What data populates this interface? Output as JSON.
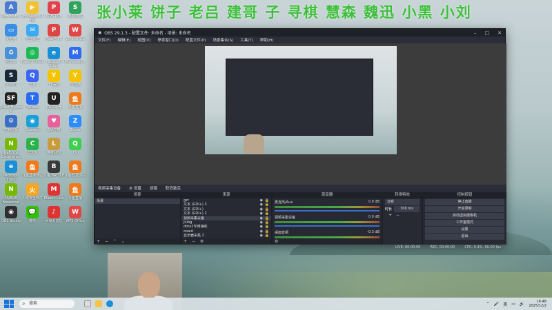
{
  "banner": "张小莱 饼子 老吕  建哥  子    寻棋  慧森 魏迅 小黑 小刘",
  "desktop_icons": [
    {
      "label": "Administr...",
      "color": "#4a7bd1",
      "glyph": "A"
    },
    {
      "label": "PotPlayer 64 bit",
      "color": "#f2c12e",
      "glyph": "▶"
    },
    {
      "label": "WPS PDF",
      "color": "#e0434c",
      "glyph": "P"
    },
    {
      "label": "WPS表格",
      "color": "#2fa35b",
      "glyph": "S"
    },
    {
      "label": "此电脑",
      "color": "#3a8ee6",
      "glyph": "▭"
    },
    {
      "label": "企业微信",
      "color": "#3ea8f0",
      "glyph": "✉"
    },
    {
      "label": "Pixel 4 FX",
      "color": "#d44",
      "glyph": "P"
    },
    {
      "label": "WPS Office",
      "color": "#e04848",
      "glyph": "W"
    },
    {
      "label": "回收站",
      "color": "#4a90d9",
      "glyph": "♻"
    },
    {
      "label": "Razer Cortex",
      "color": "#1db954",
      "glyph": "◎"
    },
    {
      "label": "Microsoft Edge",
      "color": "#1b8fd6",
      "glyph": "e"
    },
    {
      "label": "MoveMate...",
      "color": "#2f6cf0",
      "glyph": "M"
    },
    {
      "label": "Steam",
      "color": "#1b2838",
      "glyph": "S"
    },
    {
      "label": "夸克",
      "color": "#3b65f5",
      "glyph": "Q"
    },
    {
      "label": "YY语音",
      "color": "#f5c400",
      "glyph": "Y"
    },
    {
      "label": "YY直播",
      "color": "#f5c400",
      "glyph": "Y"
    },
    {
      "label": "Street Fighter 6",
      "color": "#222",
      "glyph": "SF"
    },
    {
      "label": "ToDesk",
      "color": "#2a6cf0",
      "glyph": "T"
    },
    {
      "label": "UU加速器",
      "color": "#222",
      "glyph": "U"
    },
    {
      "label": "斗鱼直播",
      "color": "#f07a1b",
      "glyph": "鱼"
    },
    {
      "label": "控制面板",
      "color": "#3a6fc4",
      "glyph": "⚙"
    },
    {
      "label": "Connect",
      "color": "#1a9fd6",
      "glyph": "◉"
    },
    {
      "label": "IDA应用",
      "color": "#e8609c",
      "glyph": "♥"
    },
    {
      "label": "Zoom",
      "color": "#2d8cff",
      "glyph": "Z"
    },
    {
      "label": "GeForce Experience",
      "color": "#76b900",
      "glyph": "N"
    },
    {
      "label": "CODK",
      "color": "#2bb24c",
      "glyph": "C"
    },
    {
      "label": "英雄联盟",
      "color": "#c89b3c",
      "glyph": "L"
    },
    {
      "label": "Qt",
      "color": "#41cd52",
      "glyph": "Q"
    },
    {
      "label": "Microsoft Edge",
      "color": "#1b8fd6",
      "glyph": "e"
    },
    {
      "label": "斗鱼直播伴侣",
      "color": "#f07a1b",
      "glyph": "鱼"
    },
    {
      "label": "斗鱼·BATTLE",
      "color": "#3a3a3a",
      "glyph": "B"
    },
    {
      "label": "斗鱼·性能测试",
      "color": "#f07a1b",
      "glyph": "鱼"
    },
    {
      "label": "NVIDIA Broadcast",
      "color": "#76b900",
      "glyph": "N"
    },
    {
      "label": "火绒安全软件",
      "color": "#f5a623",
      "glyph": "火"
    },
    {
      "label": "Maono Link",
      "color": "#d33",
      "glyph": "M"
    },
    {
      "label": "斗鱼直播",
      "color": "#f07a1b",
      "glyph": "鱼"
    },
    {
      "label": "OBS Studio",
      "color": "#302e31",
      "glyph": "◉"
    },
    {
      "label": "微信",
      "color": "#2dc100",
      "glyph": "💬"
    },
    {
      "label": "网易云音乐",
      "color": "#d33",
      "glyph": "♪"
    },
    {
      "label": "WPS Office",
      "color": "#e04848",
      "glyph": "W"
    }
  ],
  "obs": {
    "title": "OBS 29.1.3 - 配置文件: 未命名 - 场景: 未命名",
    "menu": [
      "文件(F)",
      "编辑(E)",
      "视图(V)",
      "停靠窗口(D)",
      "配置文件(P)",
      "场景集合(S)",
      "工具(T)",
      "帮助(H)"
    ],
    "source_toolbar": [
      "视频采集设备",
      "⚙ 设置",
      "滤镜",
      "取消激活"
    ],
    "docks": {
      "scenes": {
        "header": "场景",
        "items": [
          "场景"
        ]
      },
      "sources": {
        "header": "来源",
        "items": [
          "gzr",
          "文本 (GDI+) 3",
          "文本 (GDI+)",
          "文本 (GDI+) 2",
          "视频采集设备",
          "jiubg",
          "dota2专用辅助",
          "ooaid",
          "显示器采集 2"
        ]
      },
      "mixer": {
        "header": "混音器",
        "channels": [
          {
            "name": "麦克风/Aux",
            "db": "0.0 dB"
          },
          {
            "name": "视频采集设备",
            "db": "0.0 dB"
          },
          {
            "name": "桌面音频",
            "db": "-0.3 dB"
          }
        ]
      },
      "transitions": {
        "header": "转场特效",
        "type": "淡变",
        "duration_label": "时长",
        "duration": "300 ms"
      },
      "controls": {
        "header": "控制按钮",
        "buttons": [
          "停止直播",
          "开始录制",
          "启动虚拟摄像机",
          "工作室模式",
          "设置",
          "退出"
        ]
      }
    },
    "status": {
      "live": "LIVE: 00:00:00",
      "rec": "REC: 00:00:00",
      "cpu": "CPU: 0.9%, 60.00 fps"
    }
  },
  "taskbar": {
    "search_placeholder": "搜索",
    "ime": "英",
    "time": "16:48",
    "date": "2025/12/2"
  }
}
